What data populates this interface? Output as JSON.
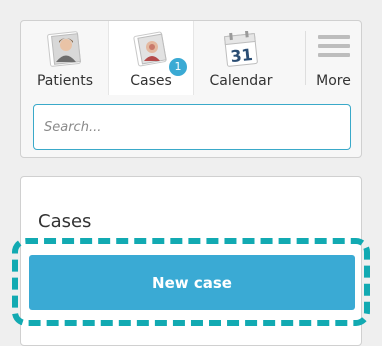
{
  "nav": {
    "items": [
      {
        "label": "Patients",
        "icon": "patient-photo-icon"
      },
      {
        "label": "Cases",
        "icon": "case-photo-icon",
        "badge": "1",
        "active": true
      },
      {
        "label": "Calendar",
        "icon": "calendar-icon",
        "calendar_day": "31"
      },
      {
        "label": "More",
        "icon": "menu-lines-icon"
      }
    ]
  },
  "search": {
    "placeholder": "Search..."
  },
  "cases": {
    "title": "Cases",
    "new_case_label": "New case"
  },
  "colors": {
    "accent": "#3aaad4",
    "highlight": "#12aab2",
    "search_border": "#3aa9c9"
  }
}
